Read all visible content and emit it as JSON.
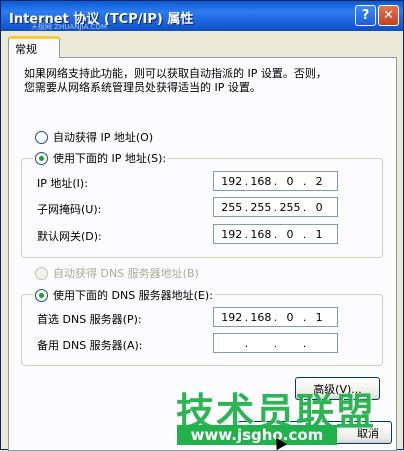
{
  "window": {
    "title": "Internet 协议 (TCP/IP) 属性",
    "watermark": "天极网 ZHUANJIA.COM",
    "help_label": "?",
    "close_label": "✕"
  },
  "tabs": [
    {
      "label": "常规",
      "selected": true
    }
  ],
  "description": {
    "line1": "如果网络支持此功能，则可以获取自动指派的 IP 设置。否则，",
    "line2": "您需要从网络系统管理员处获得适当的 IP 设置。"
  },
  "ip_mode": {
    "auto_label": "自动获得 IP 地址(O)",
    "auto_selected": false,
    "manual_label": "使用下面的 IP 地址(S):",
    "manual_selected": true
  },
  "ip_settings": {
    "fields": [
      {
        "label": "IP 地址(I):",
        "value": [
          "192",
          "168",
          "0",
          "2"
        ]
      },
      {
        "label": "子网掩码(U):",
        "value": [
          "255",
          "255",
          "255",
          "0"
        ]
      },
      {
        "label": "默认网关(D):",
        "value": [
          "192",
          "168",
          "0",
          "1"
        ]
      }
    ]
  },
  "dns_mode": {
    "auto_label": "自动获得 DNS 服务器地址(B)",
    "auto_selected": false,
    "auto_disabled": true,
    "manual_label": "使用下面的 DNS 服务器地址(E):",
    "manual_selected": true
  },
  "dns_settings": {
    "fields": [
      {
        "label": "首选 DNS 服务器(P):",
        "value": [
          "192",
          "168",
          "0",
          "1"
        ]
      },
      {
        "label": "备用 DNS 服务器(A):",
        "value": [
          "",
          "",
          "",
          ""
        ]
      }
    ]
  },
  "buttons": {
    "advanced_label": "高级(V)...",
    "cancel_label": "取消"
  },
  "branding": {
    "name": "技术员联盟",
    "url": "www.jsgho.com"
  },
  "colors": {
    "titlebar": "#1b64dc",
    "brand_green": "#22b24c",
    "tab_highlight": "#ffc83c"
  }
}
